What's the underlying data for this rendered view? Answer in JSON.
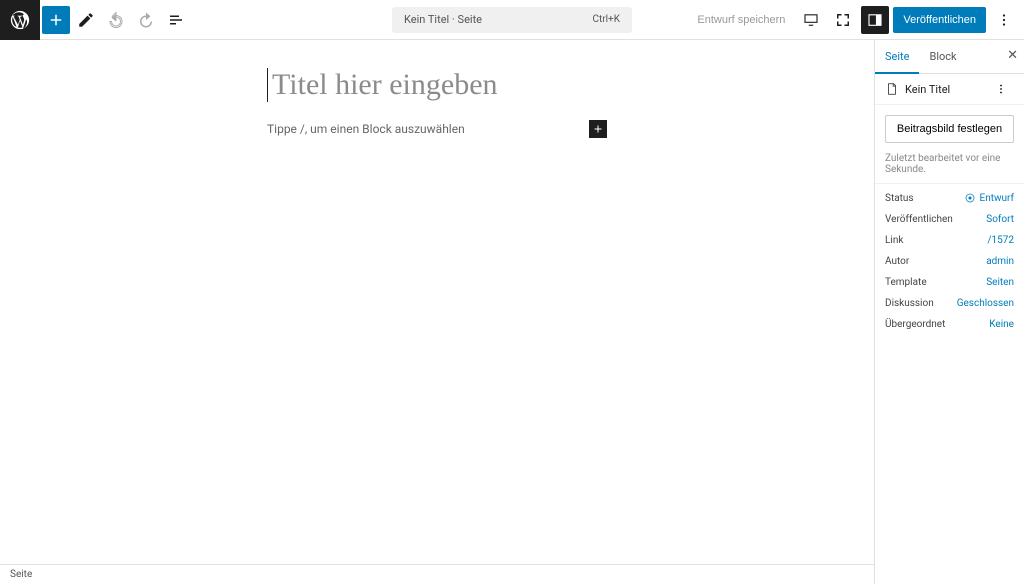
{
  "toolbar": {
    "doc_title": "Kein Titel · Seite",
    "shortcut": "Ctrl+K",
    "save_draft": "Entwurf speichern",
    "publish": "Veröffentlichen"
  },
  "editor": {
    "title_placeholder": "Titel hier eingeben",
    "block_prompt": "Tippe /, um einen Block auszuwählen"
  },
  "sidebar": {
    "tabs": {
      "page": "Seite",
      "block": "Block"
    },
    "panel_title": "Kein Titel",
    "featured_image_btn": "Beitragsbild festlegen",
    "last_edited": "Zuletzt bearbeitet vor eine Sekunde.",
    "meta": {
      "status_label": "Status",
      "status_value": "Entwurf",
      "publish_label": "Veröffentlichen",
      "publish_value": "Sofort",
      "link_label": "Link",
      "link_value": "/1572",
      "author_label": "Autor",
      "author_value": "admin",
      "template_label": "Template",
      "template_value": "Seiten",
      "discussion_label": "Diskussion",
      "discussion_value": "Geschlossen",
      "parent_label": "Übergeordnet",
      "parent_value": "Keine"
    }
  },
  "footer": {
    "breadcrumb": "Seite"
  }
}
